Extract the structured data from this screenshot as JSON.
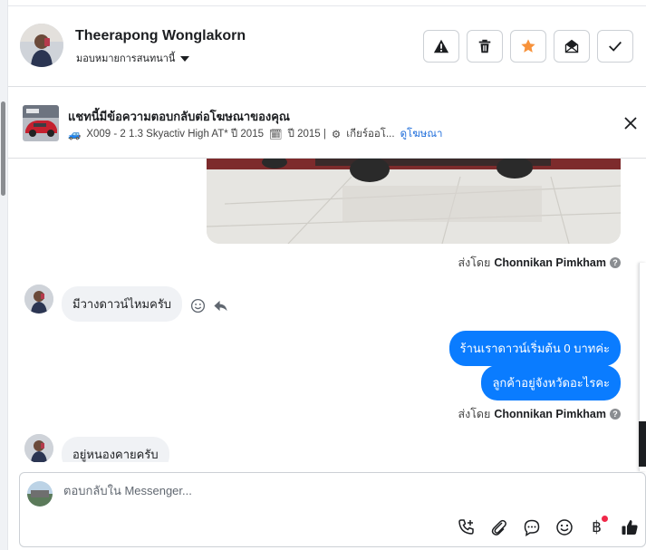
{
  "header": {
    "contact_name": "Theerapong Wonglakorn",
    "assign_label": "มอบหมายการสนทนานี้",
    "buttons": [
      {
        "name": "report-spam-button",
        "icon": "warning-icon"
      },
      {
        "name": "delete-button",
        "icon": "trash-icon"
      },
      {
        "name": "star-button",
        "icon": "star-icon",
        "color": "#f7923b"
      },
      {
        "name": "mark-unread-button",
        "icon": "envelope-open-icon"
      },
      {
        "name": "mark-done-button",
        "icon": "check-icon"
      }
    ]
  },
  "ad_banner": {
    "title": "แชทนี้มีข้อความตอบกลับต่อโฆษณาของคุณ",
    "car_emoji": "🚙",
    "description": "X009 - 2 1.3 Skyactiv High AT* ปี 2015",
    "calendar_emoji": "🗓",
    "year_text": "ปี 2015 |",
    "gear_emoji": "⚙",
    "gear_text": "เกียร์ออโ...",
    "view_ad_link": "ดูโฆษณา"
  },
  "messages": {
    "sent_by_prefix": "ส่งโดย",
    "agent_name": "Chonnikan Pimkham",
    "incoming_1": "มีวางดาวน์ไหมครับ",
    "outgoing_1": "ร้านเราดาวน์เริ่มต้น 0 บาทค่ะ",
    "outgoing_2": "ลูกค้าอยู่จังหวัดอะไรคะ",
    "incoming_2": "อยู่หนองคายครับ"
  },
  "composer": {
    "placeholder": "ตอบกลับใน Messenger...",
    "baht_symbol": "฿"
  },
  "colors": {
    "accent": "#0a7cff",
    "link": "#216fdb",
    "star": "#f7923b",
    "like": "#1c1e21"
  }
}
